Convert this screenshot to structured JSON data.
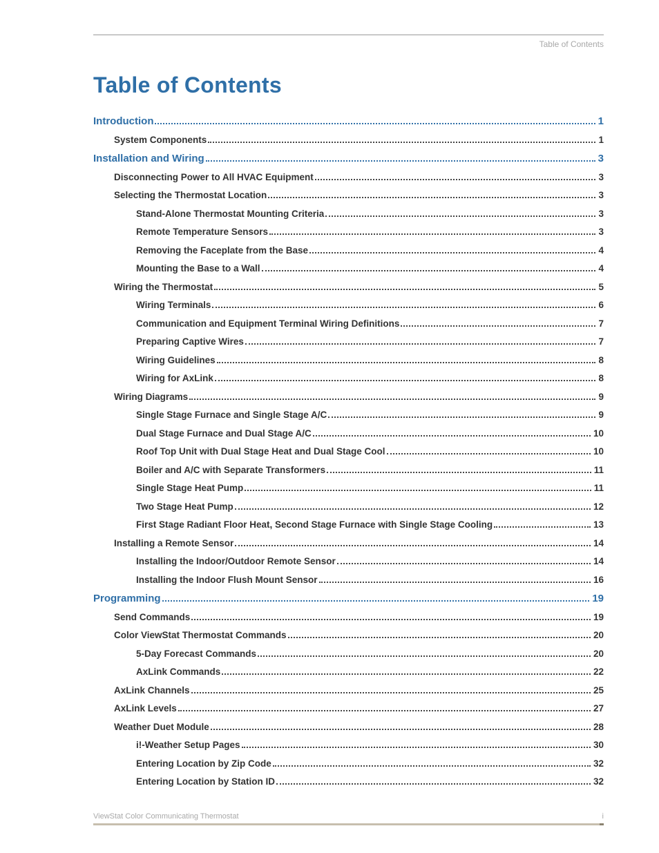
{
  "header_label": "Table of Contents",
  "title": "Table of Contents",
  "footer": {
    "doc_name": "ViewStat Color Communicating Thermostat",
    "page_num": "i"
  },
  "entries": [
    {
      "label": "Introduction",
      "page": "1",
      "level": 0,
      "kind": "section"
    },
    {
      "label": "System Components",
      "page": "1",
      "level": 1,
      "kind": "heading"
    },
    {
      "label": "Installation and Wiring",
      "page": "3",
      "level": 0,
      "kind": "section"
    },
    {
      "label": "Disconnecting Power to All HVAC Equipment",
      "page": "3",
      "level": 1,
      "kind": "heading"
    },
    {
      "label": "Selecting the Thermostat Location",
      "page": "3",
      "level": 1,
      "kind": "heading"
    },
    {
      "label": "Stand-Alone Thermostat Mounting Criteria",
      "page": "3",
      "level": 2,
      "kind": "sub"
    },
    {
      "label": "Remote Temperature Sensors",
      "page": "3",
      "level": 2,
      "kind": "sub"
    },
    {
      "label": "Removing the Faceplate from the Base",
      "page": "4",
      "level": 2,
      "kind": "sub"
    },
    {
      "label": "Mounting the Base to a Wall",
      "page": "4",
      "level": 2,
      "kind": "sub"
    },
    {
      "label": "Wiring the Thermostat",
      "page": "5",
      "level": 1,
      "kind": "heading"
    },
    {
      "label": "Wiring Terminals",
      "page": "6",
      "level": 2,
      "kind": "sub"
    },
    {
      "label": "Communication and Equipment Terminal Wiring Definitions",
      "page": "7",
      "level": 2,
      "kind": "sub"
    },
    {
      "label": "Preparing Captive Wires",
      "page": "7",
      "level": 2,
      "kind": "sub"
    },
    {
      "label": "Wiring Guidelines",
      "page": "8",
      "level": 2,
      "kind": "sub"
    },
    {
      "label": "Wiring for AxLink",
      "page": "8",
      "level": 2,
      "kind": "sub"
    },
    {
      "label": "Wiring Diagrams",
      "page": "9",
      "level": 1,
      "kind": "heading"
    },
    {
      "label": "Single Stage Furnace and Single Stage A/C",
      "page": "9",
      "level": 2,
      "kind": "sub"
    },
    {
      "label": "Dual Stage Furnace and Dual Stage A/C",
      "page": "10",
      "level": 2,
      "kind": "sub"
    },
    {
      "label": "Roof Top Unit with Dual Stage Heat and Dual Stage Cool",
      "page": "10",
      "level": 2,
      "kind": "sub"
    },
    {
      "label": "Boiler and A/C with Separate Transformers",
      "page": "11",
      "level": 2,
      "kind": "sub"
    },
    {
      "label": "Single Stage Heat Pump",
      "page": "11",
      "level": 2,
      "kind": "sub"
    },
    {
      "label": "Two Stage Heat Pump",
      "page": "12",
      "level": 2,
      "kind": "sub"
    },
    {
      "label": "First Stage Radiant Floor Heat, Second Stage Furnace with Single Stage Cooling",
      "page": "13",
      "level": 2,
      "kind": "sub"
    },
    {
      "label": "Installing a Remote Sensor",
      "page": "14",
      "level": 1,
      "kind": "heading"
    },
    {
      "label": "Installing the Indoor/Outdoor Remote Sensor",
      "page": "14",
      "level": 2,
      "kind": "sub"
    },
    {
      "label": "Installing the Indoor Flush Mount Sensor",
      "page": "16",
      "level": 2,
      "kind": "sub"
    },
    {
      "label": "Programming",
      "page": "19",
      "level": 0,
      "kind": "section"
    },
    {
      "label": "Send Commands",
      "page": "19",
      "level": 1,
      "kind": "heading"
    },
    {
      "label": "Color ViewStat Thermostat Commands",
      "page": "20",
      "level": 1,
      "kind": "heading"
    },
    {
      "label": "5-Day Forecast Commands",
      "page": "20",
      "level": 2,
      "kind": "sub"
    },
    {
      "label": "AxLink Commands",
      "page": "22",
      "level": 2,
      "kind": "sub"
    },
    {
      "label": "AxLink Channels",
      "page": "25",
      "level": 1,
      "kind": "heading"
    },
    {
      "label": "AxLink Levels",
      "page": "27",
      "level": 1,
      "kind": "heading"
    },
    {
      "label": "Weather Duet Module",
      "page": "28",
      "level": 1,
      "kind": "heading"
    },
    {
      "label": "i!-Weather Setup Pages",
      "page": "30",
      "level": 2,
      "kind": "sub"
    },
    {
      "label": "Entering Location by Zip Code",
      "page": "32",
      "level": 2,
      "kind": "sub"
    },
    {
      "label": "Entering Location by Station ID",
      "page": "32",
      "level": 2,
      "kind": "sub"
    }
  ]
}
